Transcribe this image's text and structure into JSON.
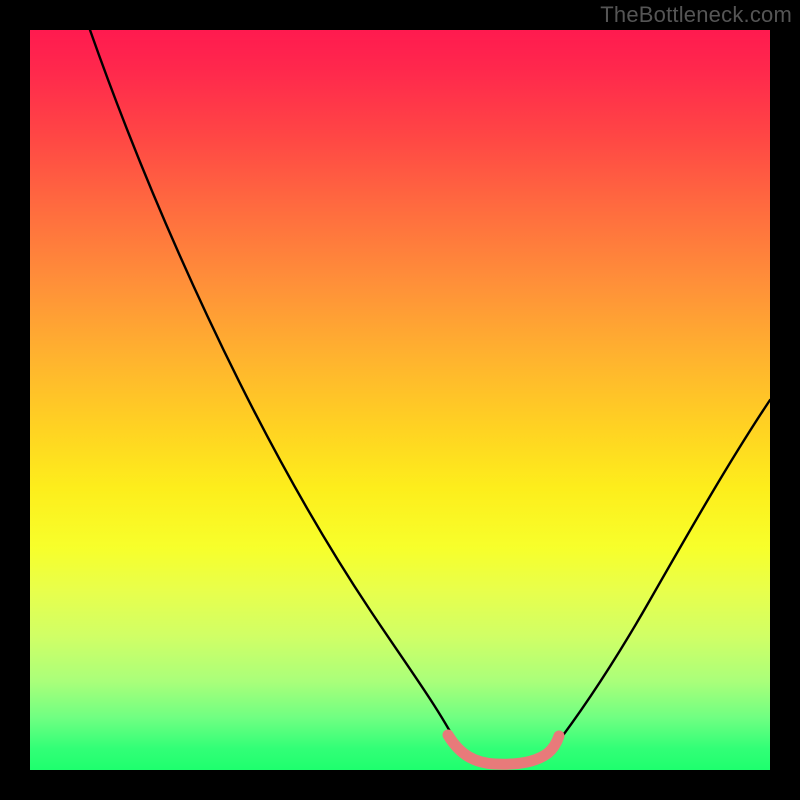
{
  "watermark": "TheBottleneck.com",
  "chart_data": {
    "type": "line",
    "title": "",
    "xlabel": "",
    "ylabel": "",
    "xlim": [
      0,
      100
    ],
    "ylim": [
      0,
      100
    ],
    "series": [
      {
        "name": "left-curve",
        "x": [
          8,
          20,
          35,
          50,
          55,
          58
        ],
        "y": [
          100,
          75,
          45,
          14,
          4,
          1
        ]
      },
      {
        "name": "right-curve",
        "x": [
          70,
          75,
          82,
          90,
          100
        ],
        "y": [
          1,
          5,
          15,
          30,
          50
        ]
      },
      {
        "name": "pink-segment",
        "x": [
          57,
          60,
          64,
          68,
          70,
          71
        ],
        "y": [
          3,
          1,
          0.5,
          0.5,
          1,
          3
        ]
      }
    ],
    "annotations": [],
    "background": "rainbow-gradient-vertical"
  },
  "colors": {
    "curve_black": "#000000",
    "pink_highlight": "#e87a7a",
    "frame_black": "#000000"
  }
}
